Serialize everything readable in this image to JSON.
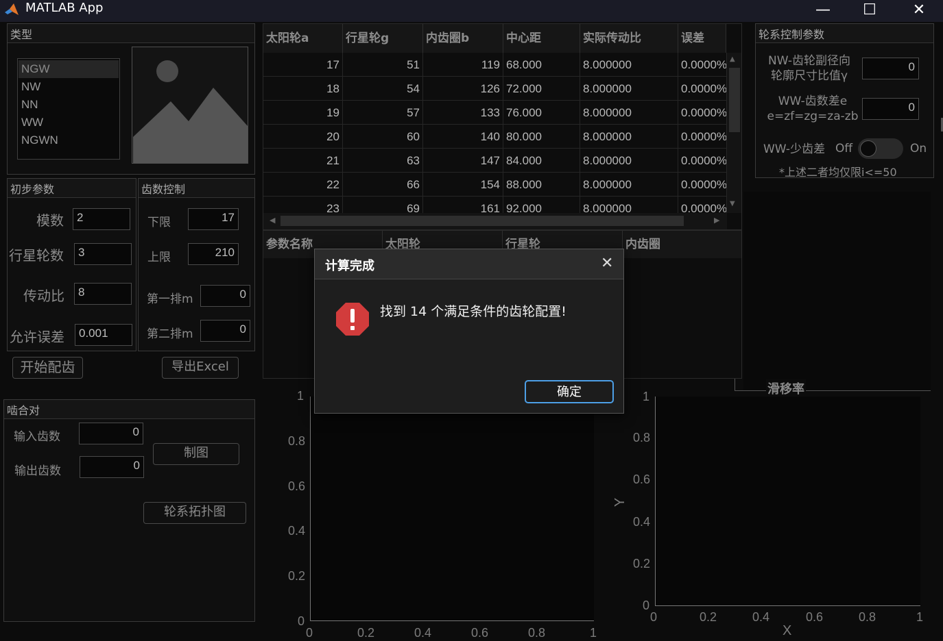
{
  "window": {
    "title": "MATLAB App",
    "minimize": "—",
    "maximize": "☐",
    "close": "✕"
  },
  "type_panel": {
    "title": "类型",
    "items": [
      "NGW",
      "NW",
      "NN",
      "WW",
      "NGWN"
    ],
    "selected": "NGW",
    "image_icon": "image-placeholder-icon"
  },
  "initial_params": {
    "title": "初步参数",
    "module_label": "模数",
    "module_value": "2",
    "planets_label": "行星轮数",
    "planets_value": "3",
    "ratio_label": "传动比",
    "ratio_value": "8",
    "tolerance_label": "允许误差",
    "tolerance_value": "0.001"
  },
  "teeth_control": {
    "title": "齿数控制",
    "lower_label": "下限",
    "lower_value": "17",
    "upper_label": "上限",
    "upper_value": "210",
    "row1_label": "第一排m",
    "row1_value": "0",
    "row2_label": "第二排m",
    "row2_value": "0"
  },
  "actions": {
    "start": "开始配齿",
    "export": "导出Excel"
  },
  "mesh_pair": {
    "title": "啮合对",
    "input_label": "输入齿数",
    "input_value": "0",
    "output_label": "输出齿数",
    "output_value": "0",
    "draw": "制图",
    "topology": "轮系拓扑图"
  },
  "results_table": {
    "columns": [
      "太阳轮a",
      "行星轮g",
      "内齿圈b",
      "中心距",
      "实际传动比",
      "误差"
    ],
    "rows": [
      [
        "17",
        "51",
        "119",
        "68.000",
        "8.000000",
        "0.0000%"
      ],
      [
        "18",
        "54",
        "126",
        "72.000",
        "8.000000",
        "0.0000%"
      ],
      [
        "19",
        "57",
        "133",
        "76.000",
        "8.000000",
        "0.0000%"
      ],
      [
        "20",
        "60",
        "140",
        "80.000",
        "8.000000",
        "0.0000%"
      ],
      [
        "21",
        "63",
        "147",
        "84.000",
        "8.000000",
        "0.0000%"
      ],
      [
        "22",
        "66",
        "154",
        "88.000",
        "8.000000",
        "0.0000%"
      ],
      [
        "23",
        "69",
        "161",
        "92.000",
        "8.000000",
        "0.0000%"
      ]
    ]
  },
  "param_table": {
    "columns": [
      "参数名称",
      "太阳轮",
      "行星轮",
      "内齿圈"
    ]
  },
  "gear_control": {
    "title": "轮系控制参数",
    "nw_label": "NW-齿轮副径向\n轮廓尺寸比值γ",
    "nw_value": "0",
    "ww_label": "WW-齿数差e\ne=zf=zg=za-zb",
    "ww_value": "0",
    "ww_small_label": "WW-少齿差",
    "switch_off": "Off",
    "switch_on": "On",
    "note": "*上述二者均仅限i<=50"
  },
  "slip_panel": {
    "title": "滑移率"
  },
  "left_axes": {
    "yticks": [
      "1",
      "0.8",
      "0.6",
      "0.4",
      "0.2",
      "0"
    ],
    "xticks": [
      "0",
      "0.2",
      "0.4",
      "0.6",
      "0.8",
      "1"
    ]
  },
  "right_axes": {
    "yticks": [
      "1",
      "0.8",
      "0.6",
      "0.4",
      "0.2",
      "0"
    ],
    "xticks": [
      "0",
      "0.2",
      "0.4",
      "0.6",
      "0.8",
      "1"
    ],
    "xlabel": "X",
    "ylabel": "Y"
  },
  "dialog": {
    "title": "计算完成",
    "message": "找到 14 个满足条件的齿轮配置!",
    "ok": "确定",
    "icon": "error-octagon-icon",
    "close_icon": "close-icon"
  },
  "colors": {
    "accent": "#4d9fe6",
    "alert": "#d23c3c",
    "background": "#0c0c0c"
  }
}
